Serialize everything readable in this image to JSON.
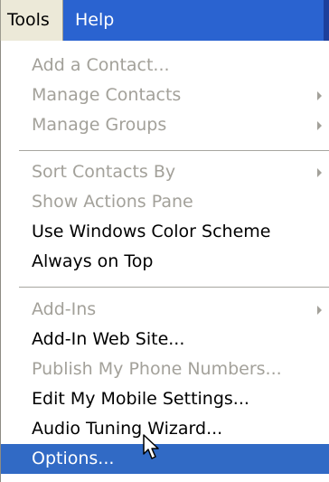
{
  "menubar": {
    "tools_label": "Tools",
    "help_label": "Help"
  },
  "dropdown": {
    "items": [
      {
        "label": "Add a Contact...",
        "enabled": false,
        "has_submenu": false
      },
      {
        "label": "Manage Contacts",
        "enabled": false,
        "has_submenu": true
      },
      {
        "label": "Manage Groups",
        "enabled": false,
        "has_submenu": true
      },
      {
        "label": "Sort Contacts By",
        "enabled": false,
        "has_submenu": true
      },
      {
        "label": "Show Actions Pane",
        "enabled": false,
        "has_submenu": false
      },
      {
        "label": "Use Windows Color Scheme",
        "enabled": true,
        "has_submenu": false
      },
      {
        "label": "Always on Top",
        "enabled": true,
        "has_submenu": false
      },
      {
        "label": "Add-Ins",
        "enabled": false,
        "has_submenu": true
      },
      {
        "label": "Add-In Web Site...",
        "enabled": true,
        "has_submenu": false
      },
      {
        "label": "Publish My Phone Numbers...",
        "enabled": false,
        "has_submenu": false
      },
      {
        "label": "Edit My Mobile Settings...",
        "enabled": true,
        "has_submenu": false
      },
      {
        "label": "Audio Tuning Wizard...",
        "enabled": true,
        "has_submenu": false
      },
      {
        "label": "Options...",
        "enabled": true,
        "has_submenu": false,
        "highlighted": true
      }
    ]
  },
  "colors": {
    "menubar_bg": "#2a63d0",
    "highlight_bg": "#316ac5",
    "disabled_text": "#a3a19a"
  },
  "icons": {
    "submenu": "submenu-arrow-icon",
    "cursor": "mouse-pointer-icon"
  }
}
